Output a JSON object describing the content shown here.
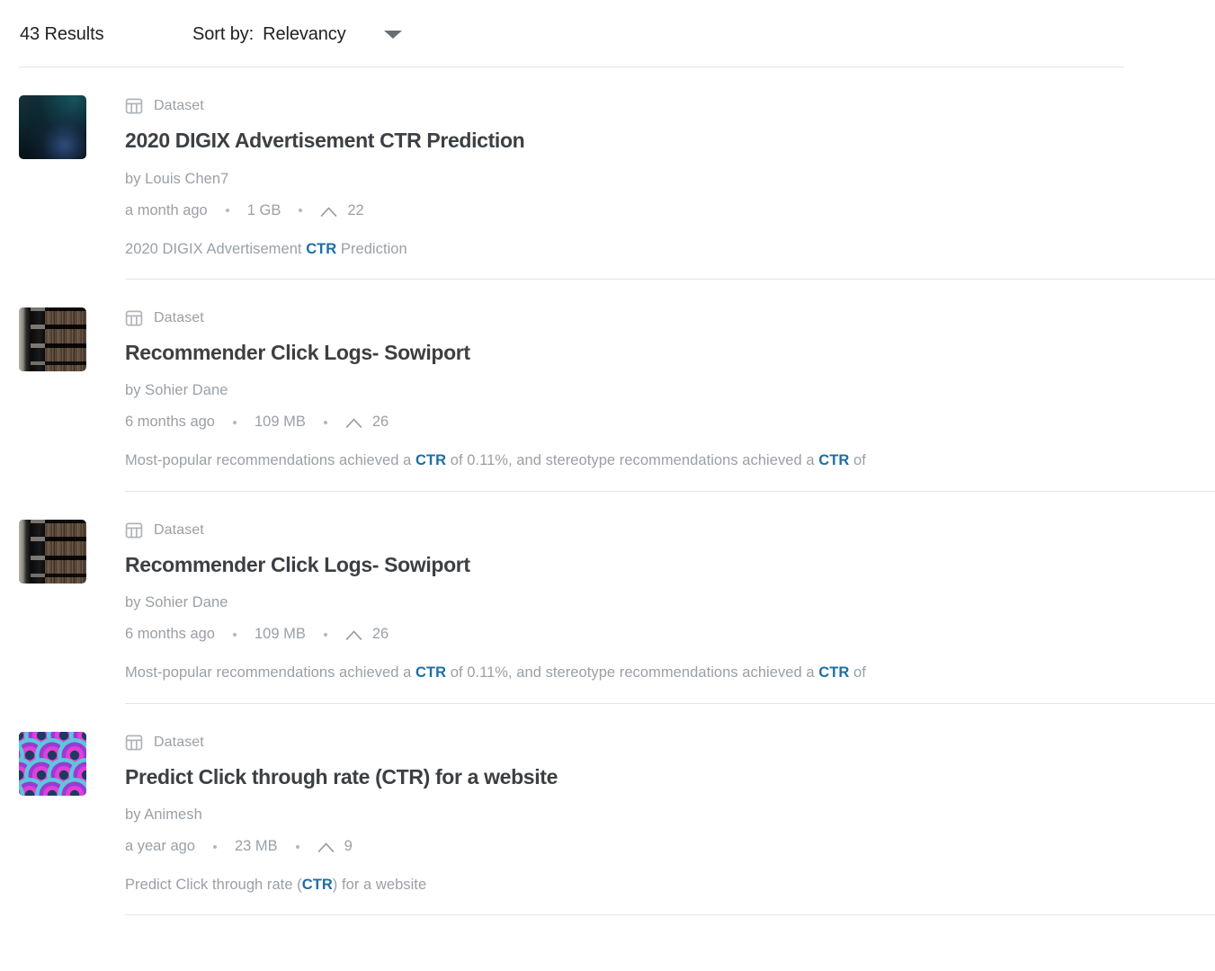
{
  "header": {
    "results_count": "43 Results",
    "sort_label": "Sort by:",
    "sort_value": "Relevancy",
    "sort_caret_icon": "chevron-down-icon"
  },
  "colors": {
    "link_highlight": "#1d6fa5",
    "title": "#3c4043",
    "muted": "#9aa0a6",
    "rule": "#e4e5e7"
  },
  "results": [
    {
      "type": "Dataset",
      "type_icon": "table-icon",
      "title": "2020 DIGIX Advertisement CTR Prediction",
      "author": "by Louis Chen7",
      "updated": "a month ago",
      "size": "1 GB",
      "votes": "22",
      "vote_icon": "caret-up-icon",
      "thumbnail": "dark-teal-gradient",
      "description_parts": [
        {
          "text": "2020 DIGIX Advertisement ",
          "highlight": false
        },
        {
          "text": "CTR",
          "highlight": true
        },
        {
          "text": " Prediction",
          "highlight": false
        }
      ]
    },
    {
      "type": "Dataset",
      "type_icon": "table-icon",
      "title": "Recommender Click Logs- Sowiport",
      "author": "by Sohier Dane",
      "updated": "6 months ago",
      "size": "109 MB",
      "votes": "26",
      "vote_icon": "caret-up-icon",
      "thumbnail": "library-shelves-photo",
      "description_parts": [
        {
          "text": "Most-popular recommendations achieved a ",
          "highlight": false
        },
        {
          "text": "CTR",
          "highlight": true
        },
        {
          "text": " of 0.11%, and stereotype recommendations achieved a ",
          "highlight": false
        },
        {
          "text": "CTR",
          "highlight": true
        },
        {
          "text": " of",
          "highlight": false
        }
      ]
    },
    {
      "type": "Dataset",
      "type_icon": "table-icon",
      "title": "Recommender Click Logs- Sowiport",
      "author": "by Sohier Dane",
      "updated": "6 months ago",
      "size": "109 MB",
      "votes": "26",
      "vote_icon": "caret-up-icon",
      "thumbnail": "library-shelves-photo",
      "description_parts": [
        {
          "text": "Most-popular recommendations achieved a ",
          "highlight": false
        },
        {
          "text": "CTR",
          "highlight": true
        },
        {
          "text": " of 0.11%, and stereotype recommendations achieved a ",
          "highlight": false
        },
        {
          "text": "CTR",
          "highlight": true
        },
        {
          "text": " of",
          "highlight": false
        }
      ]
    },
    {
      "type": "Dataset",
      "type_icon": "table-icon",
      "title": "Predict Click through rate (CTR) for a website",
      "author": "by Animesh",
      "updated": "a year ago",
      "size": "23 MB",
      "votes": "9",
      "vote_icon": "caret-up-icon",
      "thumbnail": "scallop-pattern",
      "description_parts": [
        {
          "text": "Predict Click through rate (",
          "highlight": false
        },
        {
          "text": "CTR",
          "highlight": true
        },
        {
          "text": ") for a website",
          "highlight": false
        }
      ]
    }
  ]
}
